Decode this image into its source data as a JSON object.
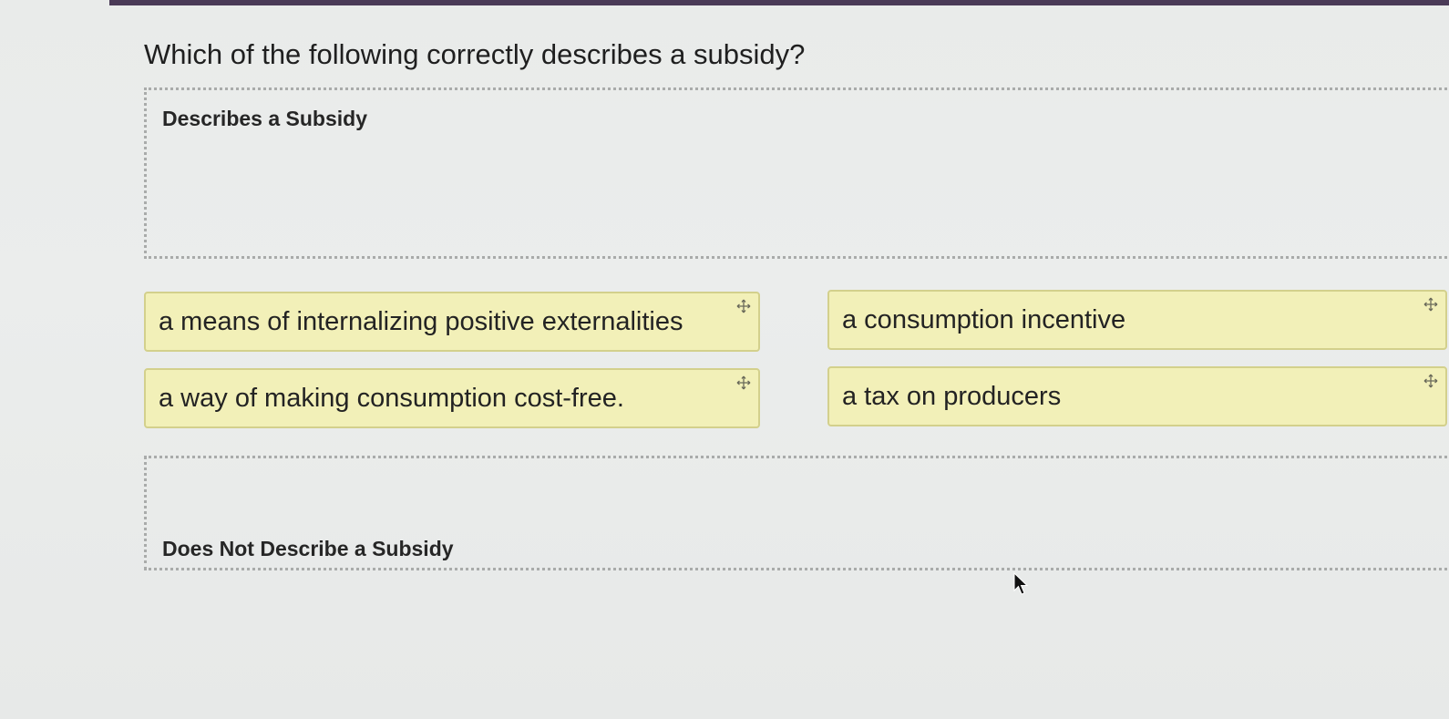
{
  "question": "Which of the following correctly describes a subsidy?",
  "zones": {
    "describes_label": "Describes a Subsidy",
    "not_describes_label": "Does Not Describe a Subsidy"
  },
  "options": [
    {
      "label": "a means of internalizing positive externalities",
      "icon": "move-icon"
    },
    {
      "label": "a consumption incentive",
      "icon": "move-icon"
    },
    {
      "label": "a way of making consumption cost-free.",
      "icon": "move-icon"
    },
    {
      "label": "a tax on producers",
      "icon": "move-icon"
    }
  ],
  "colors": {
    "chip_background": "#f2f0b8",
    "chip_border": "#d3d08c",
    "zone_border": "#a9abaa",
    "top_bar": "#4a3a57"
  }
}
